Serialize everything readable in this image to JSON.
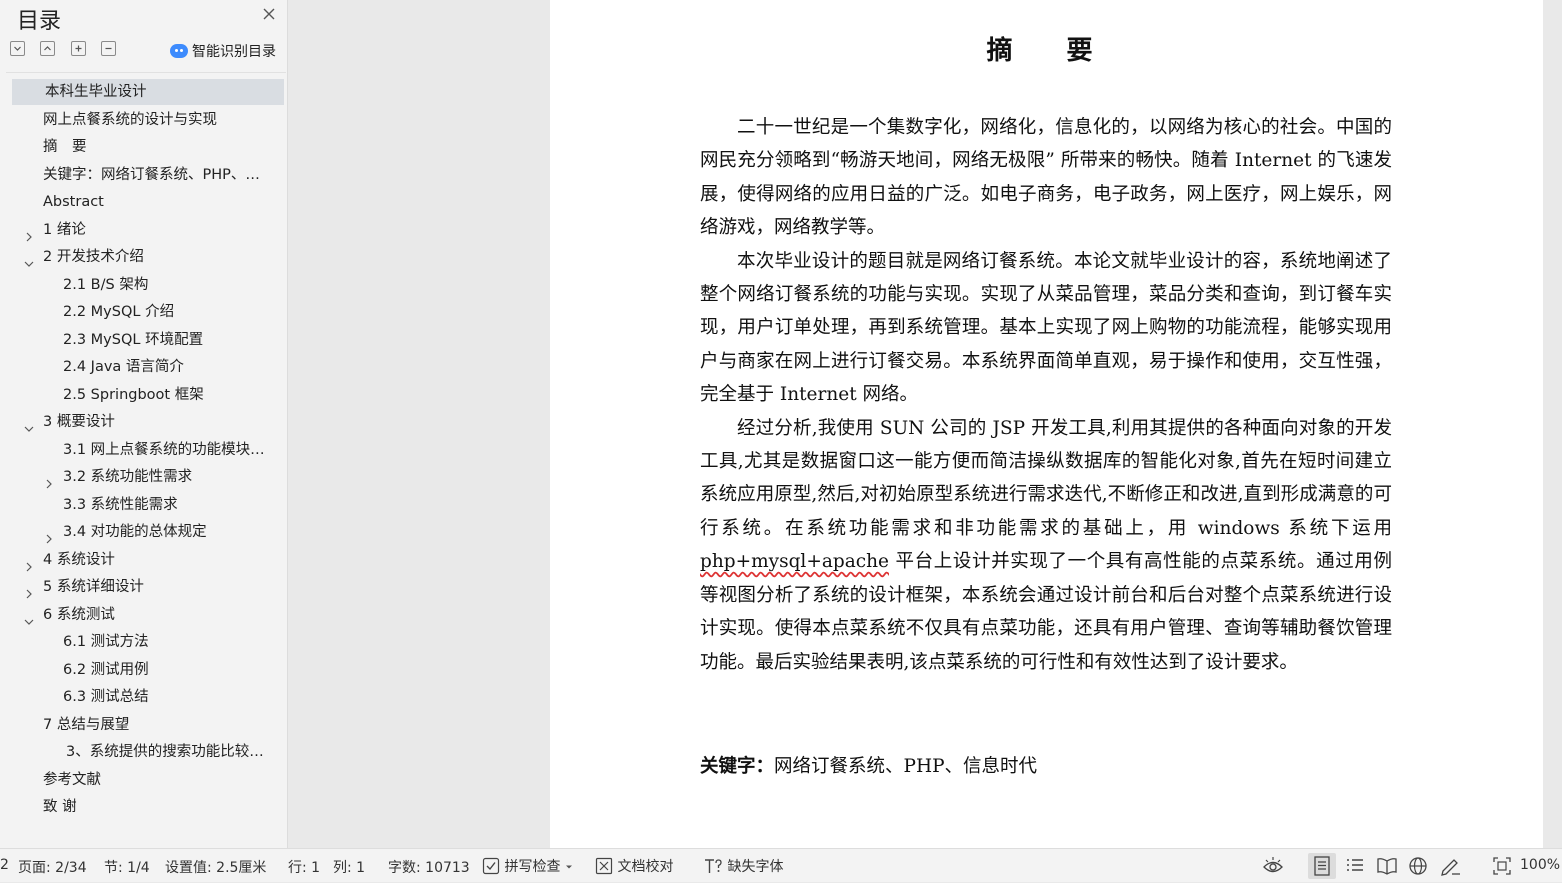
{
  "toc": {
    "title": "目录",
    "smart_toc_label": "智能识别目录",
    "items": [
      {
        "label": "本科生毕业设计",
        "level": 0,
        "toggle": "none",
        "selected": true
      },
      {
        "label": "网上点餐系统的设计与实现",
        "level": 0,
        "toggle": "none"
      },
      {
        "label": "摘　要",
        "level": 0,
        "toggle": "none"
      },
      {
        "label": "关键字：网络订餐系统、PHP、…",
        "level": 0,
        "toggle": "none"
      },
      {
        "label": "Abstract",
        "level": 0,
        "toggle": "none"
      },
      {
        "label": "1 绪论",
        "level": 0,
        "toggle": "collapsed"
      },
      {
        "label": "2 开发技术介绍",
        "level": 0,
        "toggle": "expanded"
      },
      {
        "label": "2.1 B/S 架构",
        "level": 1,
        "toggle": "none"
      },
      {
        "label": "2.2 MySQL 介绍",
        "level": 1,
        "toggle": "none"
      },
      {
        "label": "2.3 MySQL 环境配置",
        "level": 1,
        "toggle": "none"
      },
      {
        "label": "2.4 Java 语言简介",
        "level": 1,
        "toggle": "none"
      },
      {
        "label": "2.5 Springboot 框架",
        "level": 1,
        "toggle": "none"
      },
      {
        "label": "3 概要设计",
        "level": 0,
        "toggle": "expanded"
      },
      {
        "label": "3.1 网上点餐系统的功能模块…",
        "level": 1,
        "toggle": "none"
      },
      {
        "label": "3.2 系统功能性需求",
        "level": 1,
        "toggle": "collapsed"
      },
      {
        "label": "3.3 系统性能需求",
        "level": 1,
        "toggle": "none"
      },
      {
        "label": "3.4 对功能的总体规定",
        "level": 1,
        "toggle": "collapsed"
      },
      {
        "label": "4 系统设计",
        "level": 0,
        "toggle": "collapsed"
      },
      {
        "label": "5 系统详细设计",
        "level": 0,
        "toggle": "collapsed"
      },
      {
        "label": "6 系统测试",
        "level": 0,
        "toggle": "expanded"
      },
      {
        "label": "6.1 测试方法",
        "level": 1,
        "toggle": "none"
      },
      {
        "label": "6.2 测试用例",
        "level": 1,
        "toggle": "none"
      },
      {
        "label": "6.3  测试总结",
        "level": 1,
        "toggle": "none"
      },
      {
        "label": "7 总结与展望",
        "level": 0,
        "toggle": "none"
      },
      {
        "label": "3、系统提供的搜索功能比较…",
        "level": 2,
        "toggle": "none"
      },
      {
        "label": "参考文献",
        "level": 0,
        "toggle": "none"
      },
      {
        "label": "致  谢",
        "level": 0,
        "toggle": "none"
      }
    ]
  },
  "document": {
    "heading": "摘　要",
    "paragraphs": {
      "p1": "二十一世纪是一个集数字化，网络化，信息化的，以网络为核心的社会。中国的网民充分领略到“畅游天地间，网络无极限” 所带来的畅快。随着 Internet 的飞速发展，使得网络的应用日益的广泛。如电子商务，电子政务，网上医疗，网上娱乐，网络游戏，网络教学等。",
      "p2": "本次毕业设计的题目就是网络订餐系统。本论文就毕业设计的容，系统地阐述了整个网络订餐系统的功能与实现。实现了从菜品管理，菜品分类和查询，到订餐车实现，用户订单处理，再到系统管理。基本上实现了网上购物的功能流程，能够实现用户与商家在网上进行订餐交易。本系统界面简单直观，易于操作和使用，交互性强，完全基于 Internet 网络。",
      "p3_before": "经过分析,我使用  SUN 公司的 JSP 开发工具,利用其提供的各种面向对象的开发工具,尤其是数据窗口这一能方便而简洁操纵数据库的智能化对象,首先在短时间建立系统应用原型,然后,对初始原型系统进行需求迭代,不断修正和改进,直到形成满意的可行系统。在系统功能需求和非功能需求的基础上，用 windows 系统下运用 ",
      "p3_spell": "php+mysql+apache",
      "p3_after": " 平台上设计并实现了一个具有高性能的点菜系统。通过用例等视图分析了系统的设计框架，本系统会通过设计前台和后台对整个点菜系统进行设计实现。使得本点菜系统不仅具有点菜功能，还具有用户管理、查询等辅助餐饮管理功能。最后实验结果表明,该点菜系统的可行性和有效性达到了设计要求。"
    },
    "keywords_label": "关键字：",
    "keywords_value": "网络订餐系统、PHP、信息时代"
  },
  "statusbar": {
    "edge": "2",
    "page": "页面: 2/34",
    "section": "节: 1/4",
    "setting": "设置值: 2.5厘米",
    "line": "行: 1",
    "column": "列: 1",
    "word_count": "字数: 10713",
    "spell_check": "拼写检查",
    "doc_proof": "文档校对",
    "missing_fonts": "缺失字体",
    "zoom": "100%"
  }
}
